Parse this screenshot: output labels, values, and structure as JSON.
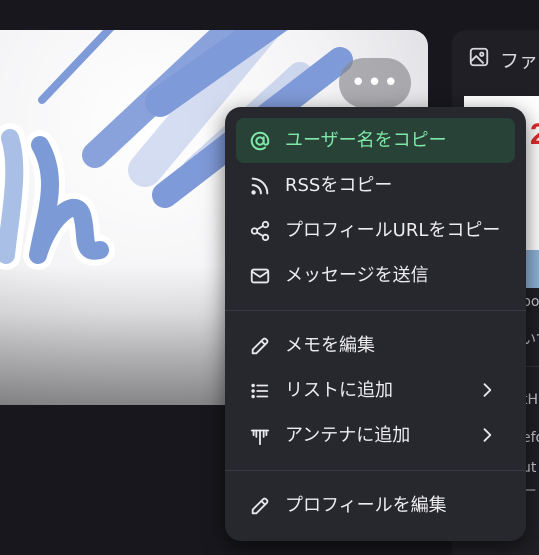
{
  "banner": {
    "more_button_label": "•••"
  },
  "side_panel": {
    "header_label": "ファ",
    "card_number": "2",
    "fragments": [
      "bo",
      "いて",
      "tH",
      "efo",
      "ut",
      "—"
    ]
  },
  "menu": {
    "section1": [
      {
        "name": "copy-username",
        "icon": "at-icon",
        "label": "ユーザー名をコピー",
        "active": true
      },
      {
        "name": "copy-rss",
        "icon": "rss-icon",
        "label": "RSSをコピー",
        "active": false
      },
      {
        "name": "copy-profile-url",
        "icon": "share-icon",
        "label": "プロフィールURLをコピー",
        "active": false
      },
      {
        "name": "send-message",
        "icon": "mail-icon",
        "label": "メッセージを送信",
        "active": false
      }
    ],
    "section2": [
      {
        "name": "edit-memo",
        "icon": "pencil-icon",
        "label": "メモを編集",
        "submenu": false
      },
      {
        "name": "add-to-list",
        "icon": "list-icon",
        "label": "リストに追加",
        "submenu": true
      },
      {
        "name": "add-to-antenna",
        "icon": "antenna-icon",
        "label": "アンテナに追加",
        "submenu": true
      }
    ],
    "section3": [
      {
        "name": "edit-profile",
        "icon": "pencil-icon",
        "label": "プロフィールを編集",
        "submenu": false
      }
    ]
  },
  "colors": {
    "background": "#17171d",
    "menu_bg": "#27272e",
    "active_bg": "#284238",
    "active_text": "#7fe8a8",
    "banner_stripe": "#7a96d8"
  }
}
